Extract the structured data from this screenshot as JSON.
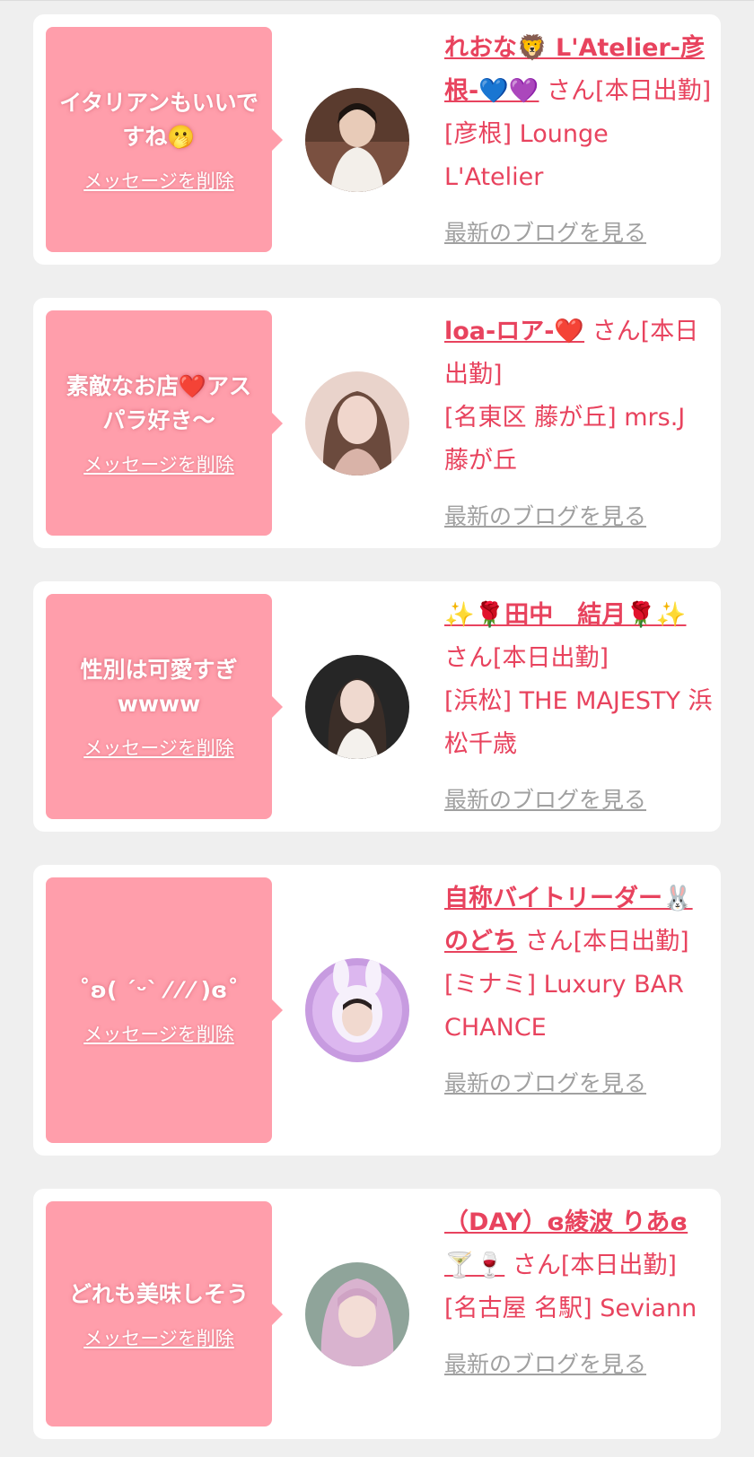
{
  "cards": [
    {
      "message": "イタリアンもいいですね🫢",
      "delete_label": "メッセージを削除",
      "name": "れおな🦁 L'Atelier-彦根-💙💜",
      "suffix": "さん[本日出勤]",
      "shop": "[彦根] Lounge L'Atelier",
      "blog_label": "最新のブログを見る"
    },
    {
      "message": "素敵なお店❤️アスパラ好き〜",
      "delete_label": "メッセージを削除",
      "name": "loa-ロア-❤️",
      "suffix": "さん[本日出勤]",
      "shop": "[名東区 藤が丘] mrs.J 藤が丘",
      "blog_label": "最新のブログを見る"
    },
    {
      "message": "性別は可愛すぎwwww",
      "delete_label": "メッセージを削除",
      "name": "✨🌹田中　結月🌹✨",
      "suffix": "さん[本日出勤]",
      "shop": "[浜松] THE MAJESTY 浜松千歳",
      "blog_label": "最新のブログを見る"
    },
    {
      "message": "˚ʚ( ´ᵕ` ⁄ ⁄ ⁄ )ɞ˚",
      "delete_label": "メッセージを削除",
      "name": "自称バイトリーダー🐰のどち",
      "suffix": "さん[本日出勤]",
      "shop": "[ミナミ] Luxury BAR CHANCE",
      "blog_label": "最新のブログを見る"
    },
    {
      "message": "どれも美味しそう",
      "delete_label": "メッセージを削除",
      "name": "（DAY）ɞ綾波 りあɞ🍸🍷",
      "suffix": "さん[本日出勤]",
      "shop": "[名古屋 名駅] Seviann",
      "blog_label": "最新のブログを見る"
    }
  ]
}
